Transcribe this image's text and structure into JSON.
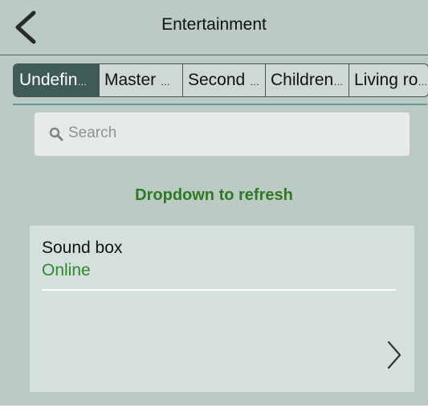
{
  "header": {
    "title": "Entertainment",
    "back_icon": "chevron-left-icon"
  },
  "tabs": [
    {
      "label": "Undefin",
      "active": true
    },
    {
      "label": "Master ",
      "active": false
    },
    {
      "label": "Second ",
      "active": false
    },
    {
      "label": "Children",
      "active": false
    },
    {
      "label": "Living ro",
      "active": false
    }
  ],
  "search": {
    "placeholder": "Search",
    "icon": "search-icon"
  },
  "refresh_hint": "Dropdown to refresh",
  "devices": [
    {
      "name": "Sound box",
      "status": "Online",
      "icon": "chevron-right-icon"
    }
  ],
  "colors": {
    "background": "#bccac6",
    "active_tab": "#3f5b57",
    "accent_green": "#2e7a22",
    "card": "#d4e0dd"
  }
}
